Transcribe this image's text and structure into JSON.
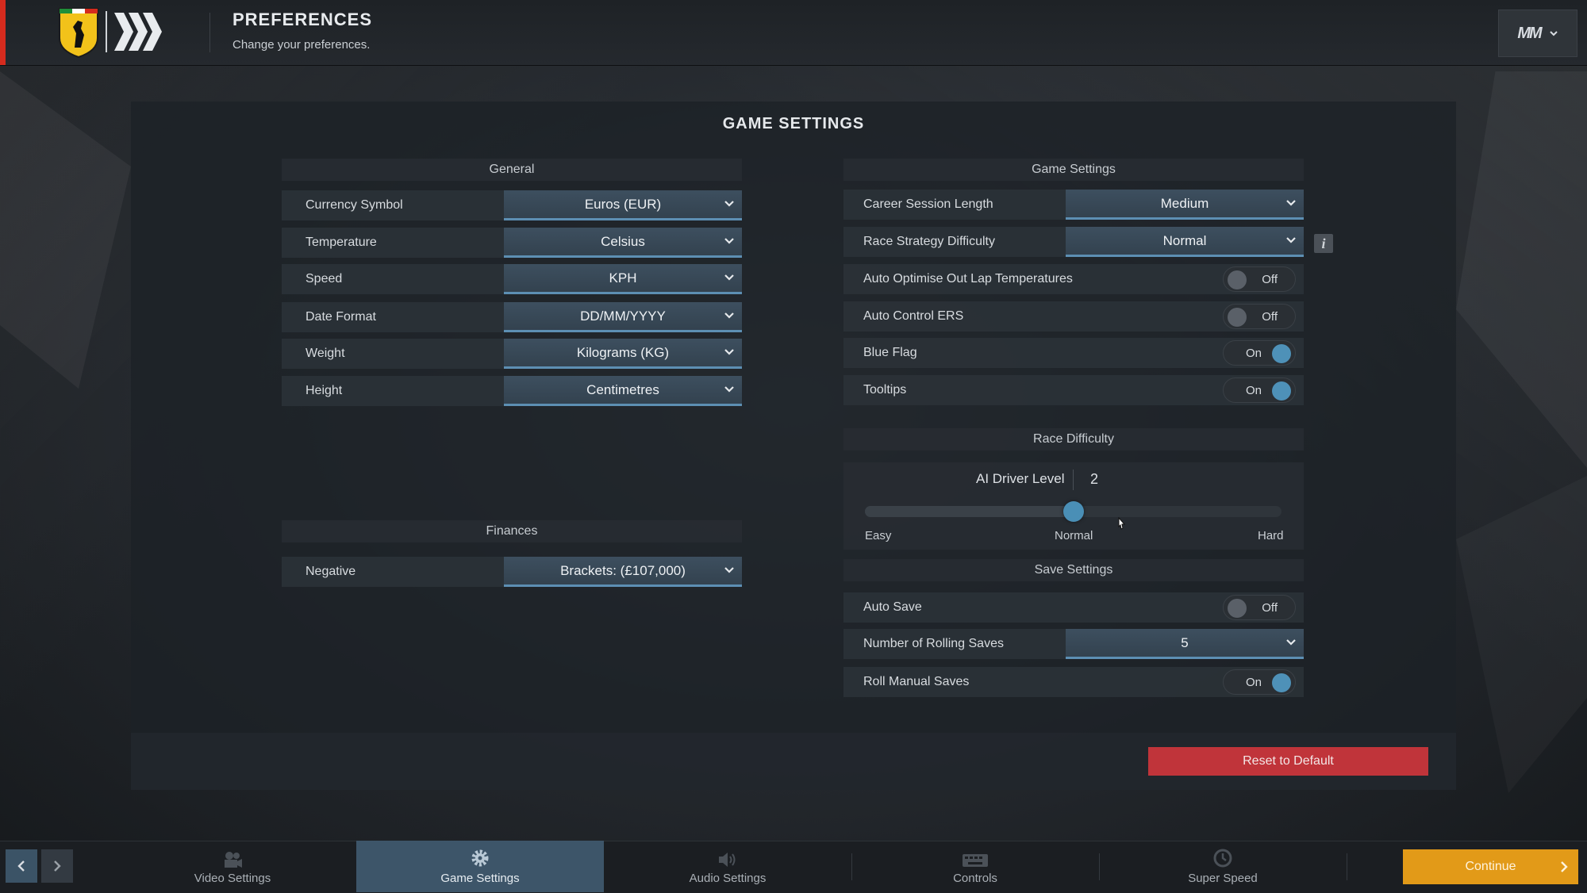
{
  "header": {
    "title": "PREFERENCES",
    "subtitle": "Change your preferences.",
    "profile_logo": "MM"
  },
  "panel": {
    "title": "GAME SETTINGS"
  },
  "general": {
    "header": "General",
    "rows": [
      {
        "label": "Currency Symbol",
        "value": "Euros (EUR)"
      },
      {
        "label": "Temperature",
        "value": "Celsius"
      },
      {
        "label": "Speed",
        "value": "KPH"
      },
      {
        "label": "Date Format",
        "value": "DD/MM/YYYY"
      },
      {
        "label": "Weight",
        "value": "Kilograms (KG)"
      },
      {
        "label": "Height",
        "value": "Centimetres"
      }
    ]
  },
  "finances": {
    "header": "Finances",
    "rows": [
      {
        "label": "Negative",
        "value": "Brackets: (£107,000)"
      }
    ]
  },
  "game_settings": {
    "header": "Game Settings",
    "career_session_length": {
      "label": "Career Session Length",
      "value": "Medium"
    },
    "race_strategy_difficulty": {
      "label": "Race Strategy Difficulty",
      "value": "Normal"
    },
    "auto_optimise": {
      "label": "Auto Optimise Out Lap Temperatures",
      "state": "Off"
    },
    "auto_control_ers": {
      "label": "Auto Control ERS",
      "state": "Off"
    },
    "blue_flag": {
      "label": "Blue Flag",
      "state": "On"
    },
    "tooltips": {
      "label": "Tooltips",
      "state": "On"
    }
  },
  "race_difficulty": {
    "header": "Race Difficulty",
    "ai_label": "AI Driver Level",
    "ai_value": "2",
    "slider": {
      "min": 0,
      "max": 4,
      "value": 2
    },
    "ticks": {
      "easy": "Easy",
      "normal": "Normal",
      "hard": "Hard"
    }
  },
  "save_settings": {
    "header": "Save Settings",
    "auto_save": {
      "label": "Auto Save",
      "state": "Off"
    },
    "rolling_saves": {
      "label": "Number of Rolling Saves",
      "value": "5"
    },
    "roll_manual_saves": {
      "label": "Roll Manual Saves",
      "state": "On"
    }
  },
  "reset_label": "Reset to Default",
  "bottom_tabs": [
    {
      "label": "Video Settings",
      "icon": "camera-icon"
    },
    {
      "label": "Game Settings",
      "icon": "gear-icon"
    },
    {
      "label": "Audio Settings",
      "icon": "speaker-icon"
    },
    {
      "label": "Controls",
      "icon": "keyboard-icon"
    },
    {
      "label": "Super Speed",
      "icon": "clock-icon"
    }
  ],
  "continue_label": "Continue",
  "colors": {
    "accent_blue": "#4e91b8",
    "reset_red": "#c0343a",
    "continue_orange": "#e29a18",
    "brand_red": "#d52b1e"
  }
}
